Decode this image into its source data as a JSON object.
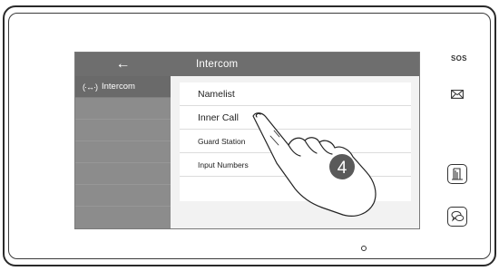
{
  "header": {
    "back_icon": "arrow-left-icon",
    "back_glyph": "←",
    "title": "Intercom"
  },
  "sidebar": {
    "items": [
      {
        "icon": "intercom-icon",
        "icon_glyph": "(·↔·)",
        "label": "Intercom",
        "active": true
      }
    ]
  },
  "menu": {
    "items": [
      {
        "label": "Namelist"
      },
      {
        "label": "Inner Call"
      },
      {
        "label": "Guard Station"
      },
      {
        "label": "Input Numbers"
      }
    ]
  },
  "device": {
    "sos_label": "SOS",
    "step_number": "4"
  }
}
